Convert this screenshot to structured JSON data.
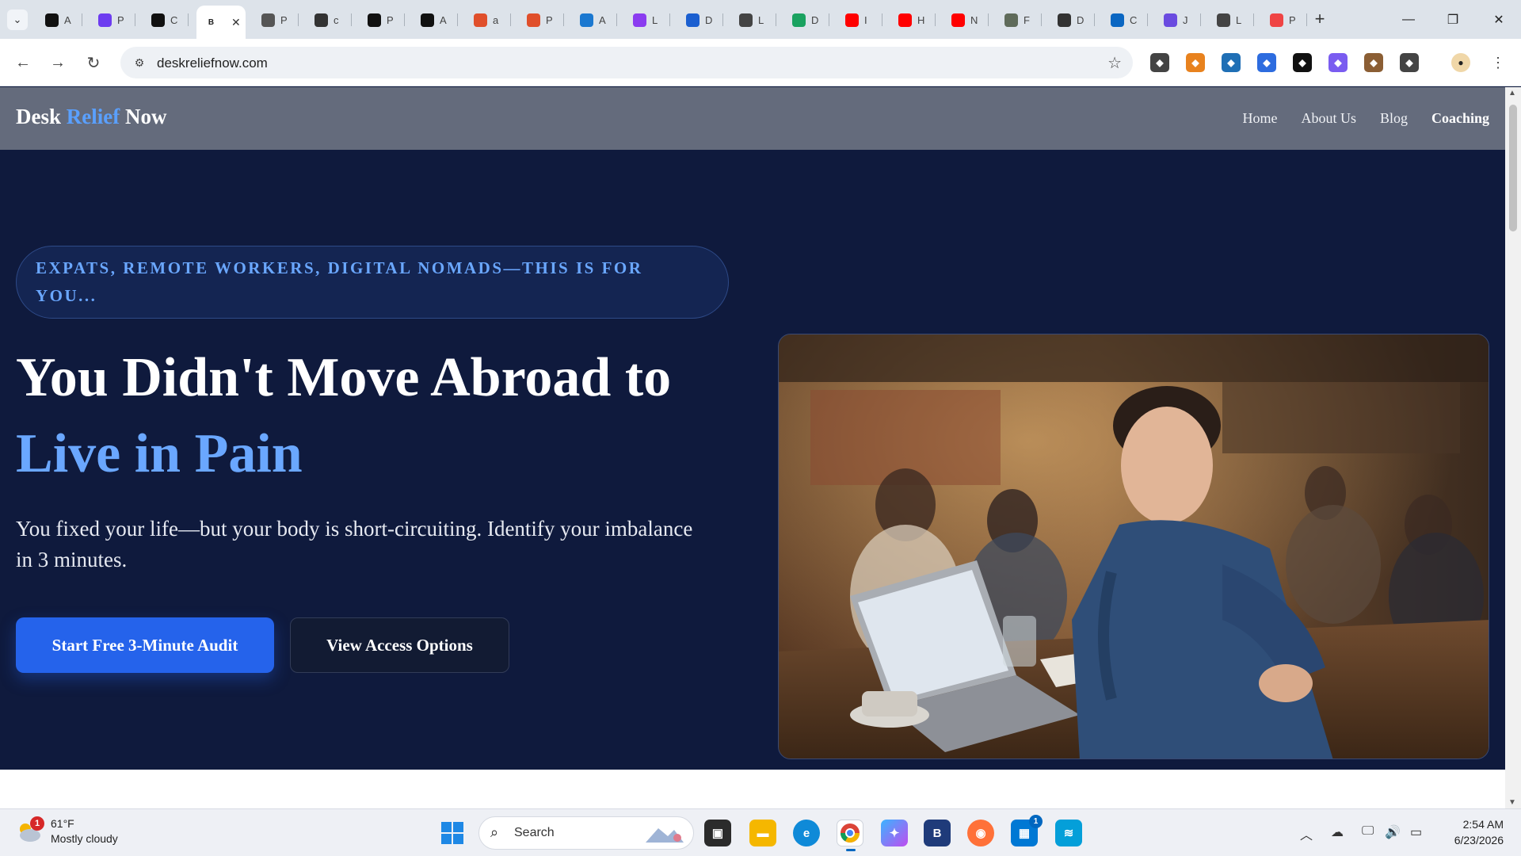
{
  "browser": {
    "tabs": [
      {
        "letter": "A",
        "icon": "pen-icon",
        "color": "#111111"
      },
      {
        "letter": "P",
        "icon": "square-icon",
        "color": "#6d3cf0"
      },
      {
        "letter": "C",
        "icon": "code-icon",
        "color": "#111111"
      },
      {
        "letter": "B",
        "icon": "b-icon",
        "color": "#ffffff",
        "active": true
      },
      {
        "letter": "P",
        "icon": "globe-icon",
        "color": "#555555"
      },
      {
        "letter": "c",
        "icon": "z-icon",
        "color": "#333333"
      },
      {
        "letter": "P",
        "icon": "pen-icon",
        "color": "#111111"
      },
      {
        "letter": "A",
        "icon": "pen-icon",
        "color": "#111111"
      },
      {
        "letter": "a",
        "icon": "arrow-icon",
        "color": "#e04f2b"
      },
      {
        "letter": "P",
        "icon": "arrow-icon",
        "color": "#e04f2b"
      },
      {
        "letter": "A",
        "icon": "bolt-icon",
        "color": "#1b78d0"
      },
      {
        "letter": "L",
        "icon": "u-icon",
        "color": "#8b3cf0"
      },
      {
        "letter": "D",
        "icon": "cap-icon",
        "color": "#1b5fd0"
      },
      {
        "letter": "L",
        "icon": "openai-icon",
        "color": "#444444"
      },
      {
        "letter": "D",
        "icon": "drive-icon",
        "color": "#1aa260"
      },
      {
        "letter": "I",
        "icon": "youtube-icon",
        "color": "#ff0000"
      },
      {
        "letter": "H",
        "icon": "youtube-icon",
        "color": "#ff0000"
      },
      {
        "letter": "N",
        "icon": "youtube-icon",
        "color": "#ff0000"
      },
      {
        "letter": "F",
        "icon": "play-icon",
        "color": "#5f6b5a"
      },
      {
        "letter": "D",
        "icon": "github-icon",
        "color": "#333333"
      },
      {
        "letter": "C",
        "icon": "linkedin-icon",
        "color": "#0a66c2"
      },
      {
        "letter": "J",
        "icon": "gear-icon",
        "color": "#6a4be0"
      },
      {
        "letter": "L",
        "icon": "openai-icon",
        "color": "#444444"
      },
      {
        "letter": "P",
        "icon": "p-icon",
        "color": "#ef4444"
      }
    ],
    "url": "deskreliefnow.com",
    "extensions": [
      {
        "icon": "shield-icon",
        "color": "#444444"
      },
      {
        "icon": "fox-icon",
        "color": "#e8821e"
      },
      {
        "icon": "bird-icon",
        "color": "#1f6fb5"
      },
      {
        "icon": "puzzle-blue-icon",
        "color": "#2d6cdf"
      },
      {
        "icon": "check-icon",
        "color": "#111111"
      },
      {
        "icon": "m-icon",
        "color": "#7a5cf0"
      },
      {
        "icon": "owl-icon",
        "color": "#8b5e34"
      },
      {
        "icon": "puzzle-icon",
        "color": "#444444"
      }
    ]
  },
  "site": {
    "logo": {
      "part1": "Desk",
      "part2": "Relief",
      "part3": "Now"
    },
    "nav": [
      "Home",
      "About Us",
      "Blog",
      "Coaching"
    ],
    "hero": {
      "eyebrow": "EXPATS, REMOTE WORKERS, DIGITAL NOMADS—THIS IS FOR YOU...",
      "headline_white": "You Didn't Move Abroad to",
      "headline_blue": "Live in Pain",
      "subtext": "You fixed your life—but your body is short-circuiting. Identify your imbalance in 3 minutes.",
      "primary_cta": "Start Free 3-Minute Audit",
      "secondary_cta": "View Access Options"
    },
    "colors": {
      "accent": "#2563eb",
      "accent_light": "#6aa7ff",
      "hero_bg": "#0f1a3d",
      "header_bg": "#646b7c"
    }
  },
  "taskbar": {
    "weather": {
      "temp": "61°F",
      "condition": "Mostly cloudy",
      "alerts": "1"
    },
    "search_label": "Search",
    "store_badge": "1",
    "time": "2:54 AM",
    "date": "6/23/2026"
  }
}
